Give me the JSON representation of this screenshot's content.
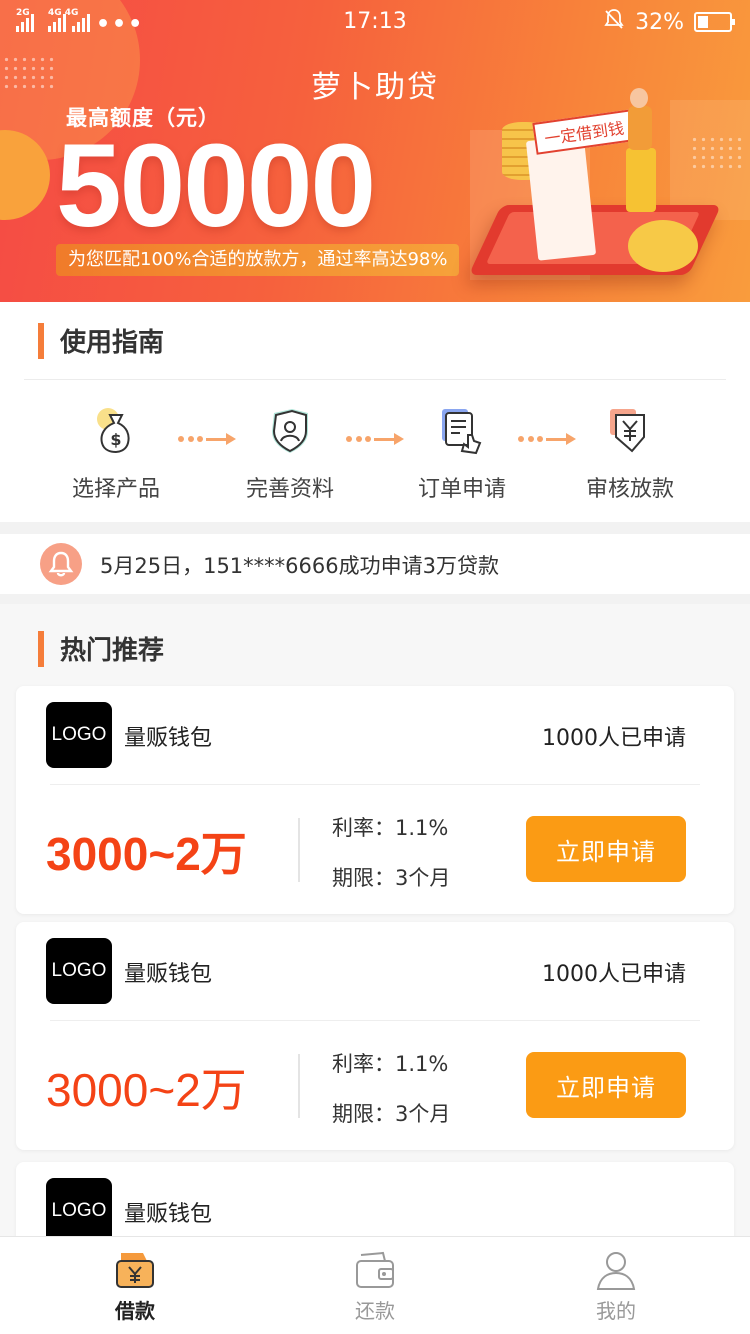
{
  "status_bar": {
    "network_left": "2G",
    "network_right": "4G 4G",
    "more": "•••",
    "time": "17:13",
    "battery": "32%",
    "battery_level": 0.32
  },
  "banner": {
    "app_title": "萝卜助贷",
    "limit_label": "最高额度（元）",
    "amount": "50000",
    "slogan": "为您匹配100%合适的放款方，通过率高达98%",
    "illustration_sign": "一定借到钱"
  },
  "guide": {
    "title": "使用指南",
    "steps": [
      {
        "label": "选择产品",
        "icon": "money-bag-icon"
      },
      {
        "label": "完善资料",
        "icon": "shield-user-icon"
      },
      {
        "label": "订单申请",
        "icon": "document-tap-icon"
      },
      {
        "label": "审核放款",
        "icon": "yuan-receive-icon"
      }
    ]
  },
  "notice": {
    "text": "5月25日，151****6666成功申请3万贷款",
    "icon": "bell-icon"
  },
  "hot": {
    "title": "热门推荐",
    "products": [
      {
        "logo": "LOGO",
        "name": "量贩钱包",
        "applied": "1000人已申请",
        "range": "3000~2万",
        "rate": "利率：1.1%",
        "term": "期限：3个月",
        "button": "立即申请"
      },
      {
        "logo": "LOGO",
        "name": "量贩钱包",
        "applied": "1000人已申请",
        "range": "3000~2万",
        "rate": "利率：1.1%",
        "term": "期限：3个月",
        "button": "立即申请"
      },
      {
        "logo": "LOGO",
        "name": "量贩钱包"
      }
    ]
  },
  "tabbar": {
    "tabs": [
      {
        "label": "借款",
        "icon": "wallet-yuan-icon",
        "active": true
      },
      {
        "label": "还款",
        "icon": "wallet-icon",
        "active": false
      },
      {
        "label": "我的",
        "icon": "user-icon",
        "active": false
      }
    ]
  },
  "colors": {
    "accent": "#f57d3a",
    "price": "#f44316",
    "button": "#fb9b14"
  }
}
